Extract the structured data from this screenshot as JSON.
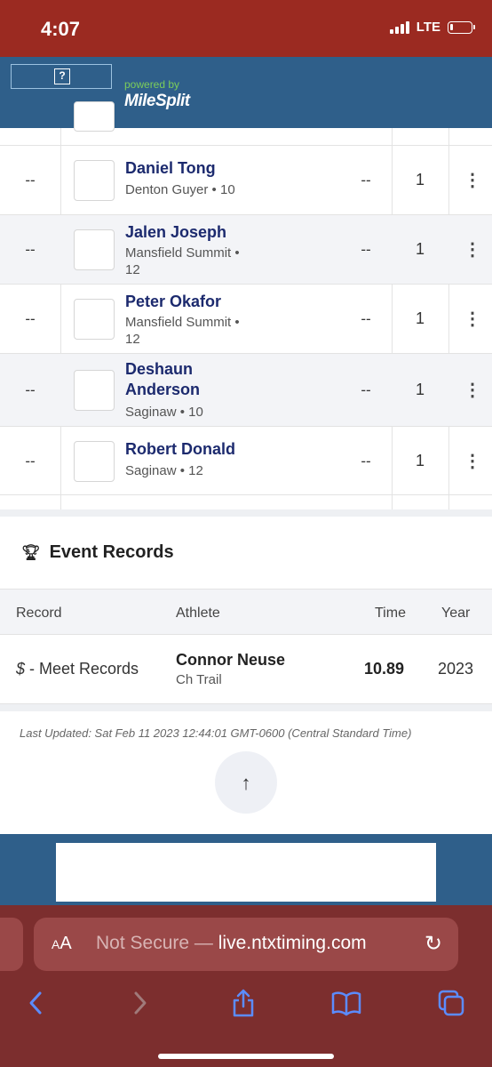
{
  "status_bar": {
    "time": "4:07",
    "network": "LTE",
    "battery_level": 0.12
  },
  "header": {
    "ad_icon": "question-mark-icon",
    "powered_by": "powered by",
    "brand": "MileSplit",
    "accent_color": "#7ccd5a"
  },
  "results": {
    "rows": [
      {
        "place": "--",
        "name": "Daniel Tong",
        "team_grade": "Denton Guyer • 10",
        "mark": "--",
        "heat": "1"
      },
      {
        "place": "--",
        "name": "Jalen Joseph",
        "team_grade": "Mansfield Summit • 12",
        "mark": "--",
        "heat": "1"
      },
      {
        "place": "--",
        "name": "Peter Okafor",
        "team_grade": "Mansfield Summit • 12",
        "mark": "--",
        "heat": "1"
      },
      {
        "place": "--",
        "name": "Deshaun Anderson",
        "team_grade": "Saginaw • 10",
        "mark": "--",
        "heat": "1"
      },
      {
        "place": "--",
        "name": "Robert Donald",
        "team_grade": "Saginaw • 12",
        "mark": "--",
        "heat": "1"
      }
    ]
  },
  "event_records": {
    "title": "Event Records",
    "columns": {
      "record": "Record",
      "athlete": "Athlete",
      "time": "Time",
      "year": "Year"
    },
    "rows": [
      {
        "symbol": "$",
        "record_type": " - Meet Records",
        "athlete": "Connor Neuse",
        "team": "Ch Trail",
        "time": "10.89",
        "year": "2023"
      }
    ]
  },
  "last_updated": "Last Updated: Sat Feb 11 2023 12:44:01 GMT-0600 (Central Standard Time)",
  "scroll_top_label": "↑",
  "browser": {
    "aa_label": "AA",
    "not_secure": "Not Secure —",
    "domain": "live.ntxtiming.com"
  },
  "colors": {
    "status_bar": "#9b2a21",
    "header": "#2f5f8a",
    "name_link": "#1c2a6e",
    "safari_bar": "#7c2e2e"
  }
}
